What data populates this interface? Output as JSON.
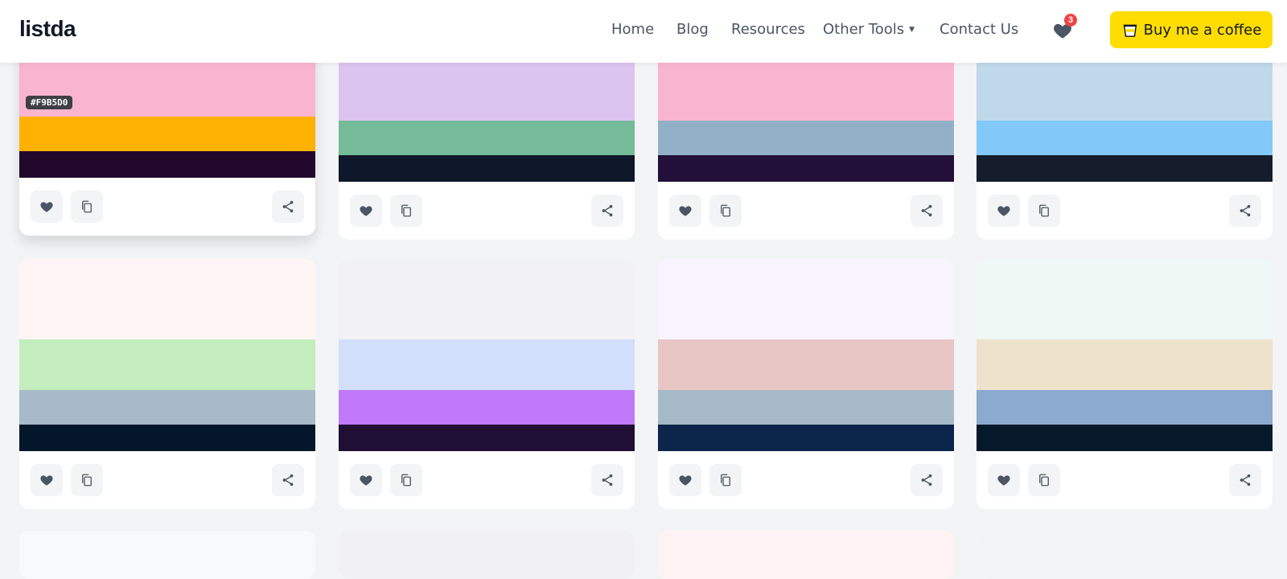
{
  "header": {
    "logo": "listda",
    "nav": [
      {
        "label": "Home"
      },
      {
        "label": "Blog"
      },
      {
        "label": "Resources"
      },
      {
        "label": "Other Tools"
      },
      {
        "label": "Contact Us"
      }
    ],
    "favorites_count": "3",
    "coffee_label": "Buy me a coffee",
    "coffee_color": "#FFDD00"
  },
  "hover_hex": "#F9B5D0",
  "palettes": [
    {
      "colors": [
        "#F9B5D0",
        "#FFB100",
        "#22092C"
      ]
    },
    {
      "colors": [
        "#DCC4F0",
        "#75BA99",
        "#0F172A"
      ]
    },
    {
      "colors": [
        "#F9B5D0",
        "#92B1C6",
        "#22103A"
      ]
    },
    {
      "colors": [
        "#BFD9EB",
        "#82C9FA",
        "#151C2B"
      ]
    },
    {
      "colors": [
        "#FFF5F5",
        "#C3EDBC",
        "#A6BAC7",
        "#04172A"
      ]
    },
    {
      "colors": [
        "#F2F1F5",
        "#D2DFFA",
        "#BF79F9",
        "#200F34"
      ]
    },
    {
      "colors": [
        "#F7F4FE",
        "#E8C6C6",
        "#A6BAC7",
        "#0C254A"
      ]
    },
    {
      "colors": [
        "#F0F8F5",
        "#EDE2CC",
        "#8CA9CF",
        "#06192A"
      ]
    },
    {
      "colors": [
        "#F8F9FA"
      ]
    },
    {
      "colors": [
        "#F1F1F5"
      ]
    },
    {
      "colors": [
        "#FEF3F2"
      ]
    },
    {
      "colors": [
        "#F2F3F5"
      ]
    }
  ]
}
